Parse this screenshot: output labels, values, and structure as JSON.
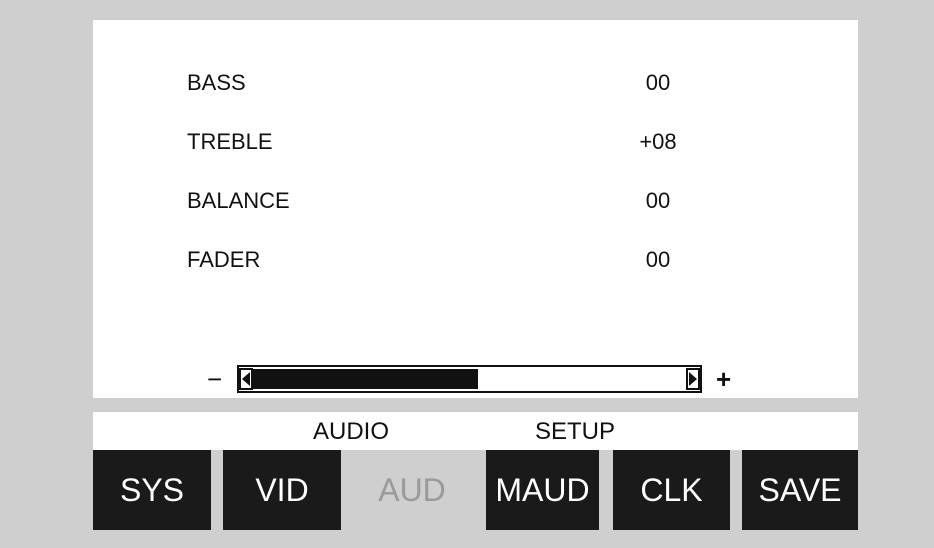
{
  "settings": [
    {
      "label": "BASS",
      "value": "00"
    },
    {
      "label": "TREBLE",
      "value": "+08"
    },
    {
      "label": "BALANCE",
      "value": "00"
    },
    {
      "label": "FADER",
      "value": "00"
    }
  ],
  "slider": {
    "minus": "−",
    "plus": "+",
    "level": 0.52
  },
  "menu": {
    "title_left": "AUDIO",
    "title_right": "SETUP",
    "buttons": [
      "SYS",
      "VID",
      "AUD",
      "MAUD",
      "CLK",
      "SAVE"
    ],
    "active": "AUD"
  },
  "colors": {
    "button_bg": "#1a1a1a",
    "screen_bg": "#ffffff",
    "frame_bg": "#cfcfcf"
  }
}
